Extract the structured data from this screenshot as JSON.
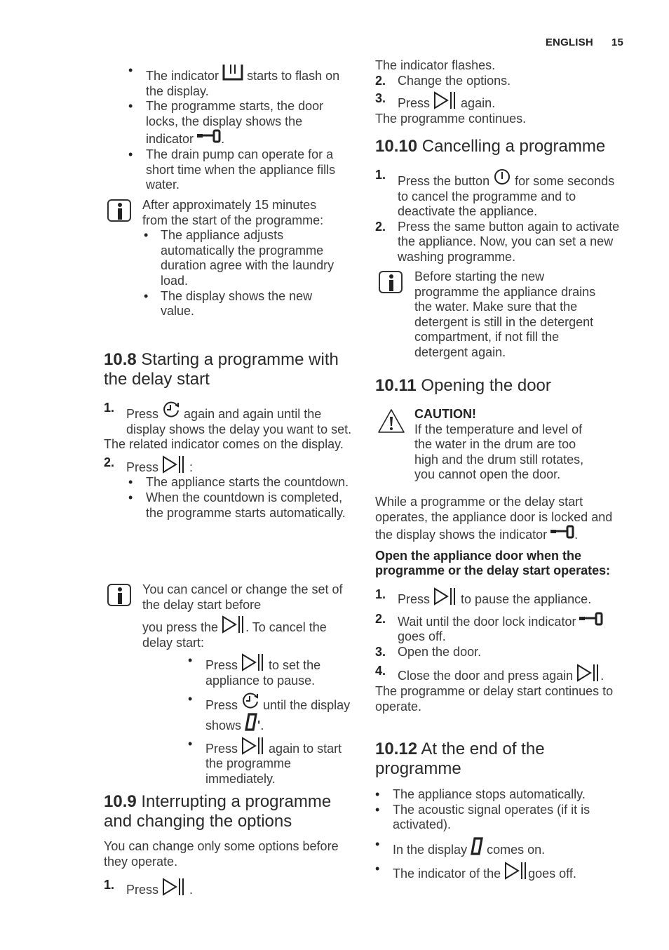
{
  "header": {
    "language": "ENGLISH",
    "page_number": "15"
  },
  "icons": {
    "start_pause": "start-pause-icon",
    "delay_start": "delay-start-icon",
    "door_lock": "door-lock-icon",
    "on_off": "on-off-icon",
    "info": "info-icon",
    "caution": "warning-icon",
    "wash_indicator": "wash-indicator-icon",
    "digit_zero": "digit-zero-icon"
  },
  "left": {
    "intro_bullets": [
      {
        "pre": "The indicator",
        "post": "starts to flash on the display."
      },
      {
        "pre": "The programme starts, the door locks, the display shows the indicator",
        "post": "."
      },
      {
        "text": "The drain pump can operate for a short time when the appliance fills water."
      }
    ],
    "info1": {
      "text": "After approximately 15 minutes from the start of the programme:",
      "bullets": [
        "The appliance adjusts automatically the programme duration agree with the laundry load.",
        "The display shows the new value."
      ]
    },
    "s108": {
      "number": "10.8",
      "title": "Starting a programme with the delay start",
      "step1": {
        "n": "1.",
        "pre": "Press",
        "post": "again and again until the display shows the delay you want to set."
      },
      "step1_note": "The related indicator comes on the display.",
      "step2": {
        "n": "2.",
        "pre": "Press",
        "post": ":"
      },
      "step2_bullets": [
        "The appliance starts the countdown.",
        "When the countdown is completed, the programme starts automatically."
      ],
      "info": {
        "line1": "You can cancel or change the set of the delay start before",
        "line2_pre": "you press the",
        "line2_post": ". To cancel the delay start:",
        "bullets": [
          {
            "pre": "Press",
            "post": "to set the appliance to pause."
          },
          {
            "pre": "Press",
            "mid": "until the display shows",
            "post": "."
          },
          {
            "pre": "Press",
            "post": "again to start the programme immediately."
          }
        ]
      }
    },
    "s109": {
      "number": "10.9",
      "title": "Interrupting a programme and changing the options",
      "intro": "You can change only some options before they operate.",
      "step1": {
        "n": "1.",
        "pre": "Press",
        "post": "."
      }
    }
  },
  "right": {
    "s109_cont": {
      "note1": "The indicator flashes.",
      "step2": {
        "n": "2.",
        "text": "Change the options."
      },
      "step3": {
        "n": "3.",
        "pre": "Press",
        "post": "again."
      },
      "note2": "The programme continues."
    },
    "s1010": {
      "number": "10.10",
      "title": "Cancelling a programme",
      "step1": {
        "n": "1.",
        "pre": "Press the button",
        "post": "for some seconds to cancel the programme and to deactivate the appliance."
      },
      "step2": {
        "n": "2.",
        "text": "Press the same button again to activate the appliance. Now, you can set a new washing programme."
      },
      "info": "Before starting the new programme the appliance drains the water. Make sure that the detergent is still in the detergent compartment, if not fill the detergent again."
    },
    "s1011": {
      "number": "10.11",
      "title": "Opening the door",
      "caution_title": "CAUTION!",
      "caution_text": "If the temperature and level of the water in the drum are too high and the drum still rotates, you cannot open the door.",
      "para_pre": "While a programme or the delay start operates, the appliance door is locked and the display shows the indicator",
      "para_post": ".",
      "bold_heading": "Open the appliance door when the programme or the delay start operates:",
      "steps": [
        {
          "n": "1.",
          "pre": "Press",
          "post": "to pause the appliance."
        },
        {
          "n": "2.",
          "pre": "Wait until the door lock indicator",
          "post": "goes off."
        },
        {
          "n": "3.",
          "pre": "Open the door.",
          "post": ""
        },
        {
          "n": "4.",
          "pre": "Close the door and press again",
          "post": "."
        }
      ],
      "outro": "The programme or delay start continues to operate."
    },
    "s1012": {
      "number": "10.12",
      "title": "At the end of the programme",
      "bullets": [
        {
          "pre": "The appliance stops automatically.",
          "post": ""
        },
        {
          "pre": "The acoustic signal operates (if it is activated).",
          "post": ""
        },
        {
          "pre": "In the display",
          "post": "comes on."
        },
        {
          "pre": "The indicator of the",
          "post": "goes off."
        }
      ]
    }
  }
}
